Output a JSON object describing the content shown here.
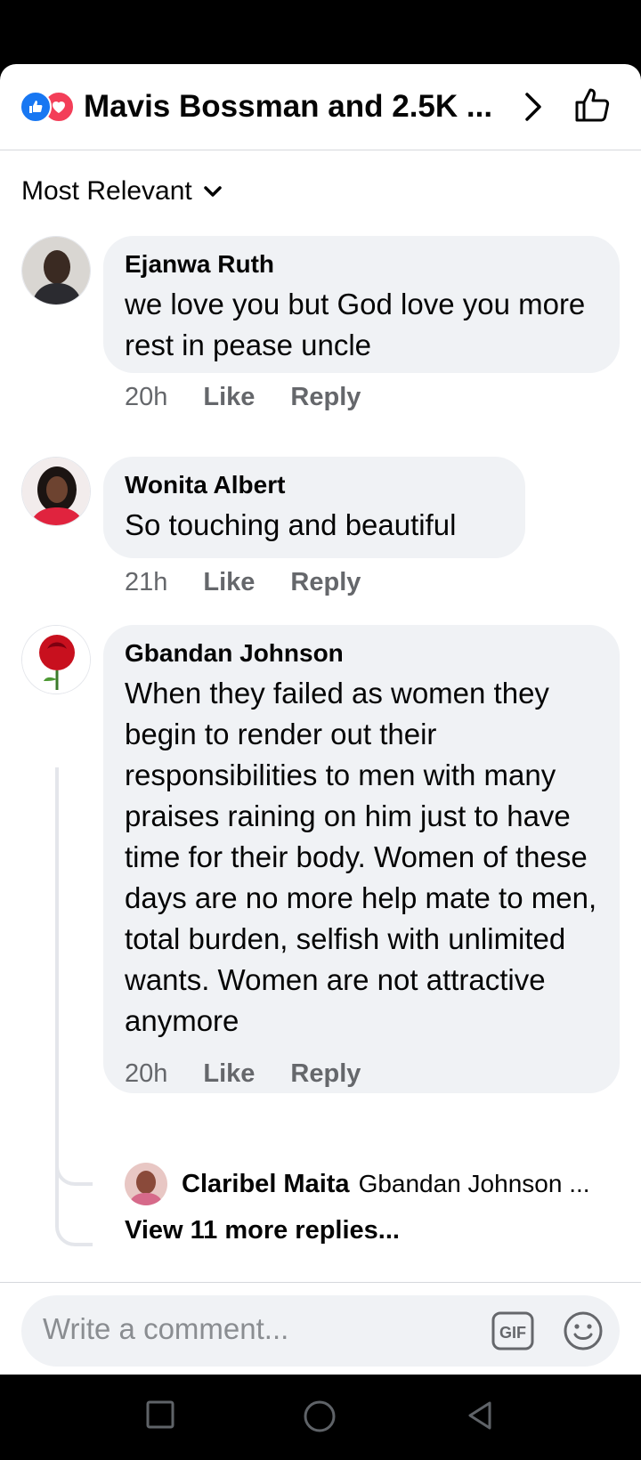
{
  "header": {
    "title": "Mavis Bossman and 2.5K ...",
    "reaction_icons": [
      "like-icon",
      "love-icon"
    ],
    "right_icons": [
      "chevron-right-icon",
      "thumbs-up-icon"
    ]
  },
  "sort": {
    "label": "Most Relevant",
    "icon": "chevron-down-icon"
  },
  "comments": [
    {
      "name": "Ejanwa Ruth",
      "text": "we love you but God love you more rest in pease uncle",
      "time": "20h",
      "like": "Like",
      "reply": "Reply"
    },
    {
      "name": "Wonita Albert",
      "text": "So touching and beautiful",
      "time": "21h",
      "like": "Like",
      "reply": "Reply"
    },
    {
      "name": "Gbandan Johnson",
      "text": "When they failed as  women they begin to render out their responsibilities to men with many praises raining on him just to have time for their body. Women of these days are no more help mate to men,  total burden, selfish with unlimited wants. Women are not attractive anymore",
      "time": "20h",
      "like": "Like",
      "reply": "Reply",
      "reply_preview": {
        "name": "Claribel Maita",
        "snippet": "Gbandan Johnson ..."
      },
      "view_more": "View 11 more replies..."
    }
  ],
  "composer": {
    "placeholder": "Write a comment...",
    "gif_label": "GIF",
    "emoji_icon": "smiley-icon"
  },
  "navbar": {
    "icons": [
      "recents-square-icon",
      "home-circle-icon",
      "back-triangle-icon"
    ]
  },
  "colors": {
    "like_blue": "#1877f2",
    "love_red": "#f33e58",
    "bubble_bg": "#f0f2f5",
    "meta_gray": "#65676b"
  }
}
